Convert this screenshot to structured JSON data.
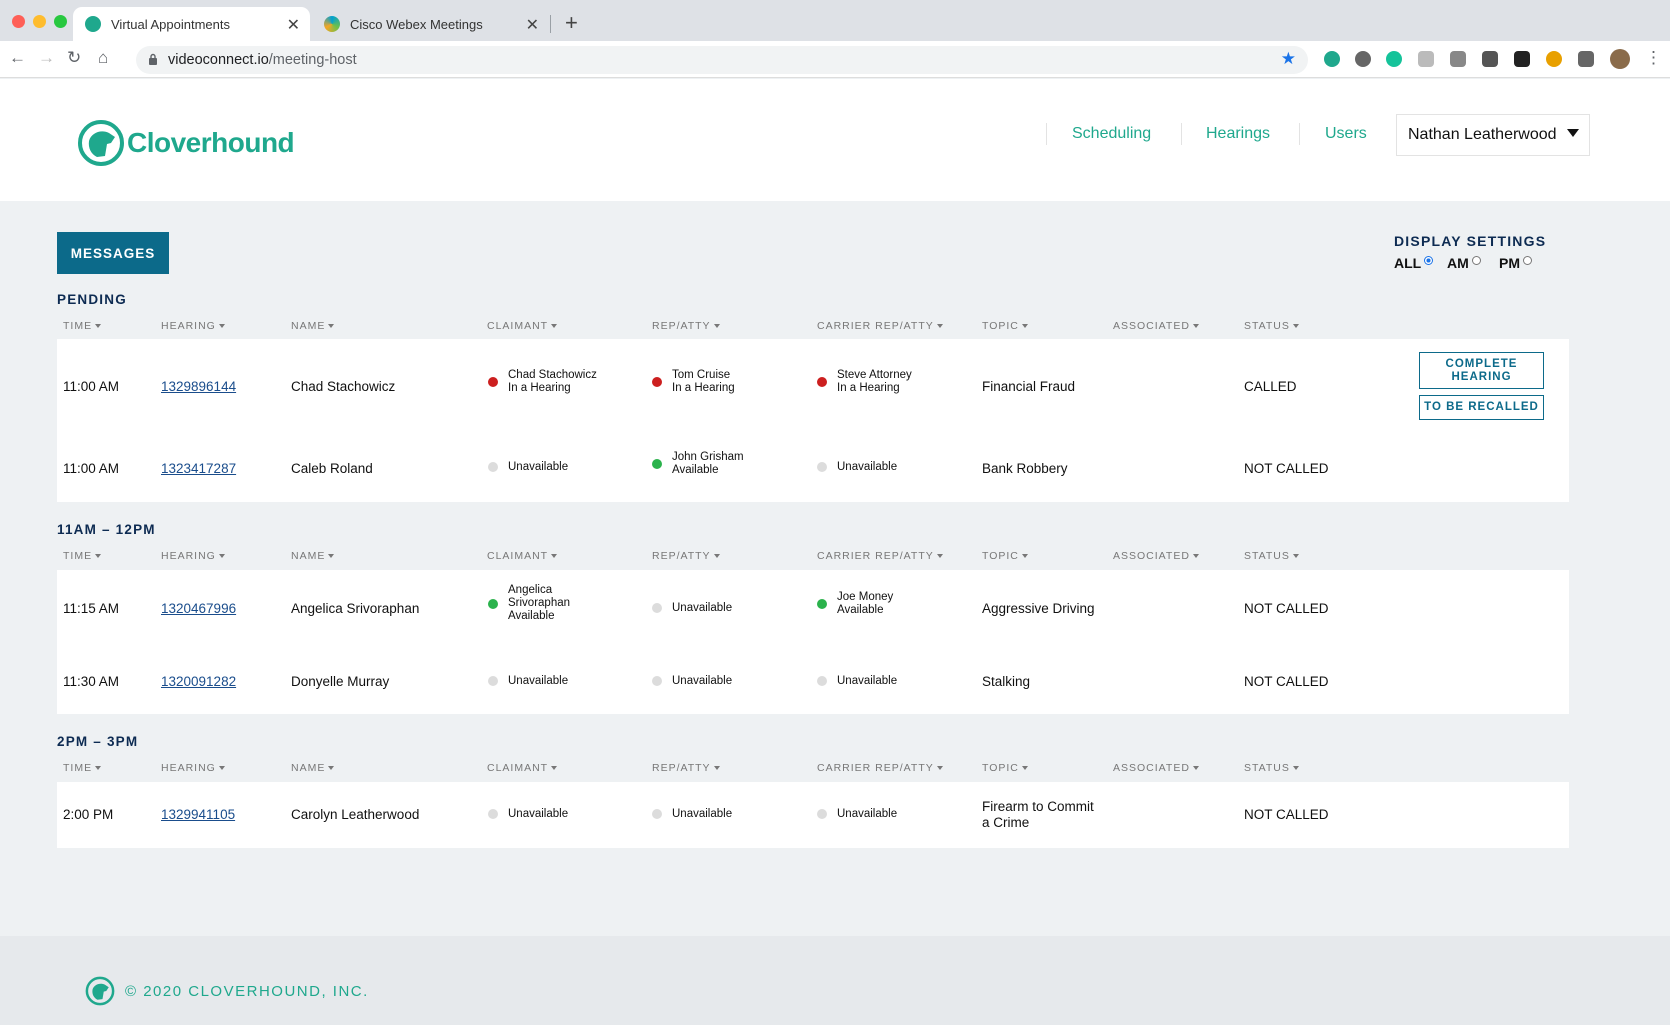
{
  "browser": {
    "tabs": [
      {
        "title": "Virtual Appointments",
        "active": true
      },
      {
        "title": "Cisco Webex Meetings",
        "active": false
      }
    ],
    "url_host": "videoconnect.io",
    "url_path": "/meeting-host"
  },
  "header": {
    "brand": "Cloverhound",
    "nav": [
      "Scheduling",
      "Hearings",
      "Users"
    ],
    "user": "Nathan Leatherwood",
    "accent_color": "#1fa88d"
  },
  "toolbar": {
    "messages_label": "MESSAGES",
    "display_settings_title": "DISPLAY SETTINGS",
    "display_options": [
      {
        "label": "ALL",
        "selected": true
      },
      {
        "label": "AM",
        "selected": false
      },
      {
        "label": "PM",
        "selected": false
      }
    ]
  },
  "columns": [
    "TIME",
    "HEARING",
    "NAME",
    "CLAIMANT",
    "REP/ATTY",
    "CARRIER REP/ATTY",
    "TOPIC",
    "ASSOCIATED",
    "STATUS"
  ],
  "sections": [
    {
      "title": "PENDING",
      "rows": [
        {
          "time": "11:00 AM",
          "hearing": "1329896144",
          "name": "Chad Stachowicz",
          "claimant": {
            "state": "red",
            "lines": [
              "Chad Stachowicz",
              "In a Hearing"
            ]
          },
          "rep": {
            "state": "red",
            "lines": [
              "Tom Cruise",
              "In a Hearing"
            ]
          },
          "carrier": {
            "state": "red",
            "lines": [
              "Steve Attorney",
              "In a Hearing"
            ]
          },
          "topic": [
            "Financial Fraud"
          ],
          "associated": "",
          "status": "CALLED",
          "actions": [
            "COMPLETE HEARING",
            "TO BE RECALLED"
          ]
        },
        {
          "time": "11:00 AM",
          "hearing": "1323417287",
          "name": "Caleb Roland",
          "claimant": {
            "state": "gray",
            "lines": [
              "Unavailable"
            ]
          },
          "rep": {
            "state": "green",
            "lines": [
              "John Grisham",
              "Available"
            ]
          },
          "carrier": {
            "state": "gray",
            "lines": [
              "Unavailable"
            ]
          },
          "topic": [
            "Bank Robbery"
          ],
          "associated": "",
          "status": "NOT CALLED",
          "actions": []
        }
      ]
    },
    {
      "title": "11AM – 12PM",
      "rows": [
        {
          "time": "11:15 AM",
          "hearing": "1320467996",
          "name": "Angelica Srivoraphan",
          "claimant": {
            "state": "green",
            "lines": [
              "Angelica",
              "Srivoraphan",
              "Available"
            ]
          },
          "rep": {
            "state": "gray",
            "lines": [
              "Unavailable"
            ]
          },
          "carrier": {
            "state": "green",
            "lines": [
              "Joe Money",
              "Available"
            ]
          },
          "topic": [
            "Aggressive Driving"
          ],
          "associated": "",
          "status": "NOT CALLED",
          "actions": []
        },
        {
          "time": "11:30 AM",
          "hearing": "1320091282",
          "name": "Donyelle Murray",
          "claimant": {
            "state": "gray",
            "lines": [
              "Unavailable"
            ]
          },
          "rep": {
            "state": "gray",
            "lines": [
              "Unavailable"
            ]
          },
          "carrier": {
            "state": "gray",
            "lines": [
              "Unavailable"
            ]
          },
          "topic": [
            "Stalking"
          ],
          "associated": "",
          "status": "NOT CALLED",
          "actions": []
        }
      ]
    },
    {
      "title": "2PM – 3PM",
      "rows": [
        {
          "time": "2:00 PM",
          "hearing": "1329941105",
          "name": "Carolyn Leatherwood",
          "claimant": {
            "state": "gray",
            "lines": [
              "Unavailable"
            ]
          },
          "rep": {
            "state": "gray",
            "lines": [
              "Unavailable"
            ]
          },
          "carrier": {
            "state": "gray",
            "lines": [
              "Unavailable"
            ]
          },
          "topic": [
            "Firearm to Commit",
            "a Crime"
          ],
          "associated": "",
          "status": "NOT CALLED",
          "actions": []
        }
      ]
    }
  ],
  "footer": {
    "text": "© 2020 CLOVERHOUND, INC."
  }
}
